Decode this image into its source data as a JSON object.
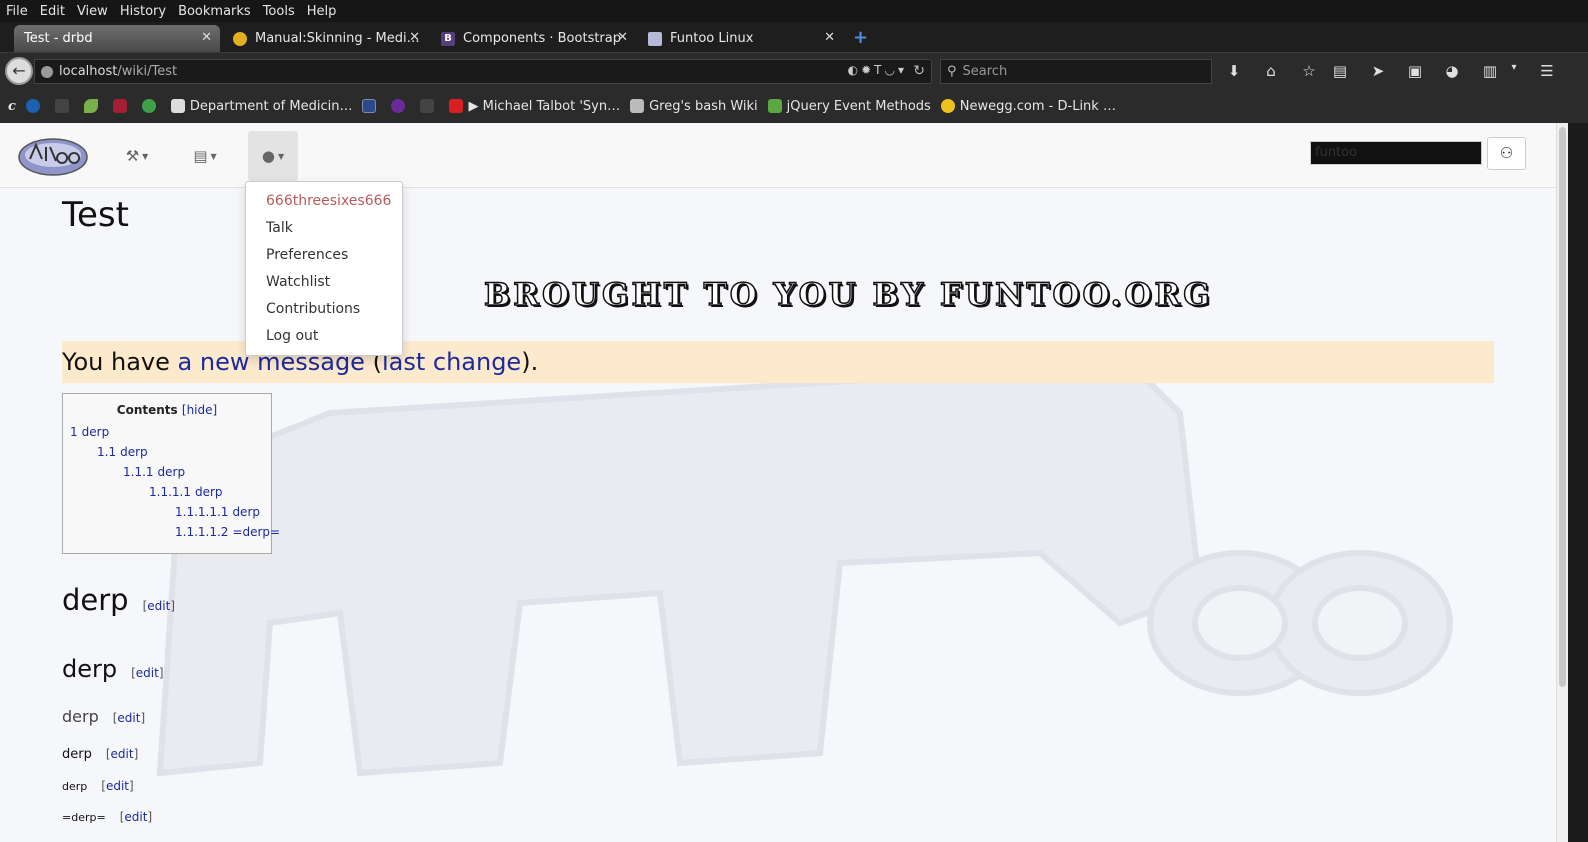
{
  "menubar": {
    "items": [
      "File",
      "Edit",
      "View",
      "History",
      "Bookmarks",
      "Tools",
      "Help"
    ]
  },
  "tabs": [
    {
      "label": "Test - drbd",
      "active": true,
      "icon": "page-icon"
    },
    {
      "label": "Manual:Skinning - Medi…",
      "active": false,
      "icon": "mediawiki-icon"
    },
    {
      "label": "Components · Bootstrap",
      "active": false,
      "icon": "bootstrap-icon"
    },
    {
      "label": "Funtoo Linux",
      "active": false,
      "icon": "funtoo-icon"
    }
  ],
  "urlbar": {
    "host": "localhost",
    "path": "/wiki/Test"
  },
  "searchbar": {
    "placeholder": "Search"
  },
  "bookmarks": [
    {
      "label": "",
      "icon": "c-icon"
    },
    {
      "label": "",
      "icon": "wave-icon"
    },
    {
      "label": "",
      "icon": "square-icon"
    },
    {
      "label": "",
      "icon": "leaf-icon"
    },
    {
      "label": "",
      "icon": "mit-icon"
    },
    {
      "label": "",
      "icon": "globe-icon"
    },
    {
      "label": "Department of Medicin…",
      "icon": "med-icon"
    },
    {
      "label": "",
      "icon": "h-icon"
    },
    {
      "label": "",
      "icon": "peace-icon"
    },
    {
      "label": "",
      "icon": "square-icon"
    },
    {
      "label": "▶ Michael Talbot 'Syn…",
      "icon": "youtube-icon"
    },
    {
      "label": "Greg's bash Wiki",
      "icon": "wiki-icon"
    },
    {
      "label": "jQuery Event Methods",
      "icon": "w3-icon"
    },
    {
      "label": "Newegg.com - D-Link …",
      "icon": "egg-icon"
    }
  ],
  "site": {
    "search_value": "funtoo",
    "user_menu": [
      "666threesixes666",
      "Talk",
      "Preferences",
      "Watchlist",
      "Contributions",
      "Log out"
    ]
  },
  "page": {
    "title": "Test",
    "banner": "BROUGHT TO YOU BY FUNTOO.ORG",
    "notice_pre": "You have ",
    "notice_link1": "a new message",
    "notice_mid": " (",
    "notice_link2": "last change",
    "notice_post": ")."
  },
  "toc": {
    "title": "Contents",
    "hide": "hide",
    "items": [
      {
        "num": "1",
        "text": "derp"
      },
      {
        "num": "1.1",
        "text": "derp"
      },
      {
        "num": "1.1.1",
        "text": "derp"
      },
      {
        "num": "1.1.1.1",
        "text": "derp"
      },
      {
        "num": "1.1.1.1.1",
        "text": "derp"
      },
      {
        "num": "1.1.1.1.2",
        "text": "=derp="
      }
    ]
  },
  "headings": [
    {
      "text": "derp",
      "edit": "edit"
    },
    {
      "text": "derp",
      "edit": "edit"
    },
    {
      "text": "derp",
      "edit": "edit"
    },
    {
      "text": "derp",
      "edit": "edit"
    },
    {
      "text": "derp",
      "edit": "edit"
    },
    {
      "text": "=derp=",
      "edit": "edit"
    }
  ]
}
